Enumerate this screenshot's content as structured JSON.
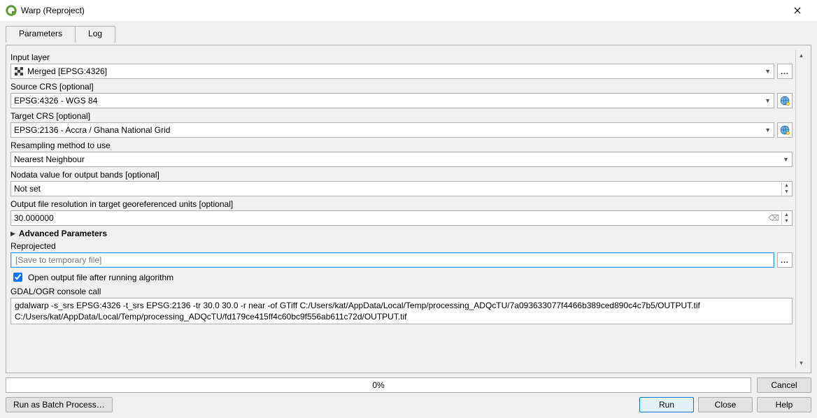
{
  "window": {
    "title": "Warp (Reproject)"
  },
  "tabs": {
    "parameters": "Parameters",
    "log": "Log"
  },
  "labels": {
    "input_layer": "Input layer",
    "source_crs": "Source CRS [optional]",
    "target_crs": "Target CRS [optional]",
    "resampling": "Resampling method to use",
    "nodata": "Nodata value for output bands [optional]",
    "out_res": "Output file resolution in target georeferenced units [optional]",
    "advanced": "Advanced Parameters",
    "reprojected": "Reprojected",
    "open_after": "Open output file after running algorithm",
    "console": "GDAL/OGR console call"
  },
  "values": {
    "input_layer": "Merged [EPSG:4326]",
    "source_crs": "EPSG:4326 - WGS 84",
    "target_crs": "EPSG:2136 - Accra / Ghana National Grid",
    "resampling": "Nearest Neighbour",
    "nodata": "Not set",
    "out_res": "30.000000",
    "reprojected_placeholder": "[Save to temporary file]",
    "open_after_checked": true,
    "console": "gdalwarp -s_srs EPSG:4326 -t_srs EPSG:2136 -tr 30.0 30.0 -r near -of GTiff C:/Users/kat/AppData/Local/Temp/processing_ADQcTU/7a093633077f4466b389ced890c4c7b5/OUTPUT.tif C:/Users/kat/AppData/Local/Temp/processing_ADQcTU/fd179ce415ff4c60bc9f556ab611c72d/OUTPUT.tif"
  },
  "progress": {
    "text": "0%"
  },
  "buttons": {
    "cancel": "Cancel",
    "batch": "Run as Batch Process…",
    "run": "Run",
    "close": "Close",
    "help": "Help",
    "browse": "…"
  }
}
